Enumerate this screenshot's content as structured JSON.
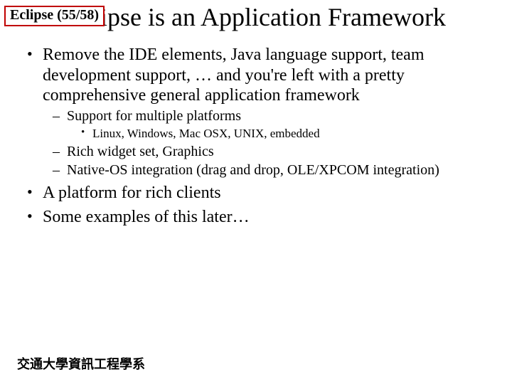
{
  "slide_label": "Eclipse (55/58)",
  "title": "Eclipse is an Application Framework",
  "bullets": {
    "b1": "Remove the IDE elements, Java language support, team development support, … and you're left with a pretty comprehensive general application framework",
    "b1_1": "Support for multiple platforms",
    "b1_1_1": "Linux, Windows, Mac OSX, UNIX, embedded",
    "b1_2": "Rich widget set, Graphics",
    "b1_3": "Native-OS integration (drag and drop, OLE/XPCOM integration)",
    "b2": "A platform for rich clients",
    "b3": "Some examples of this later…"
  },
  "footer": "交通大學資訊工程學系"
}
